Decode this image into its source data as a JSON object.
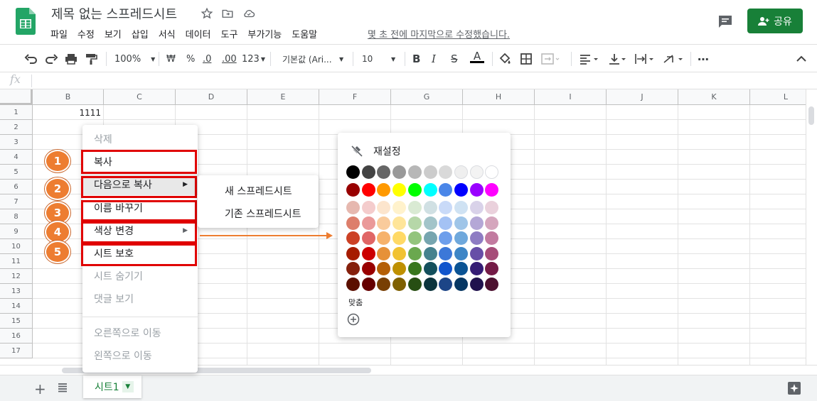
{
  "header": {
    "doc_title": "제목 없는 스프레드시트",
    "menu": [
      "파일",
      "수정",
      "보기",
      "삽입",
      "서식",
      "데이터",
      "도구",
      "부가기능",
      "도움말"
    ],
    "last_edit": "몇 초 전에 마지막으로 수정했습니다.",
    "share_label": "공유"
  },
  "toolbar": {
    "zoom": "100%",
    "currency": "₩",
    "percent": "%",
    "dec_decrease": ".0",
    "dec_increase": ".00",
    "more_formats": "123",
    "font": "기본값 (Ari...",
    "font_size": "10"
  },
  "grid": {
    "columns": [
      "B",
      "C",
      "D",
      "E",
      "F",
      "G",
      "H",
      "I",
      "J",
      "K",
      "L"
    ],
    "rows": [
      "1",
      "2",
      "3",
      "4",
      "5",
      "6",
      "7",
      "8",
      "9",
      "10",
      "11",
      "12",
      "13",
      "14",
      "15",
      "16",
      "17"
    ],
    "cell_b1": "1111"
  },
  "context_menu": {
    "items": [
      {
        "label": "삭제",
        "disabled": true
      },
      {
        "label": "복사",
        "disabled": false
      },
      {
        "label": "다음으로 복사",
        "disabled": false
      },
      {
        "label": "이름 바꾸기",
        "disabled": false
      },
      {
        "label": "색상 변경",
        "disabled": false
      },
      {
        "label": "시트 보호",
        "disabled": false
      },
      {
        "label": "시트 숨기기",
        "disabled": true
      },
      {
        "label": "댓글 보기",
        "disabled": true
      },
      {
        "label": "오른쪽으로 이동",
        "disabled": true
      },
      {
        "label": "왼쪽으로 이동",
        "disabled": true
      }
    ]
  },
  "submenu": {
    "new_spreadsheet": "새 스프레드시트",
    "existing_spreadsheet": "기존 스프레드시트"
  },
  "badges": [
    "1",
    "2",
    "3",
    "4",
    "5"
  ],
  "palette": {
    "reset_label": "재설정",
    "custom_label": "맞춤",
    "rows": [
      [
        "#000000",
        "#434343",
        "#666666",
        "#999999",
        "#b7b7b7",
        "#cccccc",
        "#d9d9d9",
        "#efefef",
        "#f3f3f3",
        "#ffffff"
      ],
      [
        "#980000",
        "#ff0000",
        "#ff9900",
        "#ffff00",
        "#00ff00",
        "#00ffff",
        "#4a86e8",
        "#0000ff",
        "#9900ff",
        "#ff00ff"
      ],
      [
        "#e6b8af",
        "#f4cccc",
        "#fce5cd",
        "#fff2cc",
        "#d9ead3",
        "#d0e0e3",
        "#c9daf8",
        "#cfe2f3",
        "#d9d2e9",
        "#ead1dc"
      ],
      [
        "#dd7e6b",
        "#ea9999",
        "#f9cb9c",
        "#ffe599",
        "#b6d7a8",
        "#a2c4c9",
        "#a4c2f4",
        "#9fc5e8",
        "#b4a7d6",
        "#d5a6bd"
      ],
      [
        "#cc4125",
        "#e06666",
        "#f6b26b",
        "#ffd966",
        "#93c47d",
        "#76a5af",
        "#6d9eeb",
        "#6fa8dc",
        "#8e7cc3",
        "#c27ba0"
      ],
      [
        "#a61c00",
        "#cc0000",
        "#e69138",
        "#f1c232",
        "#6aa84f",
        "#45818e",
        "#3c78d8",
        "#3d85c6",
        "#674ea7",
        "#a64d79"
      ],
      [
        "#85200c",
        "#990000",
        "#b45f06",
        "#bf9000",
        "#38761d",
        "#134f5c",
        "#1155cc",
        "#0b5394",
        "#351c75",
        "#741b47"
      ],
      [
        "#5b0f00",
        "#660000",
        "#783f04",
        "#7f6000",
        "#274e13",
        "#0c343d",
        "#1c4587",
        "#073763",
        "#20124d",
        "#4c1130"
      ]
    ]
  },
  "sheet_tab": {
    "label": "시트1"
  },
  "colors": {
    "brand_green": "#188038",
    "badge_orange": "#ed7d31",
    "highlight_red": "#e00000"
  }
}
